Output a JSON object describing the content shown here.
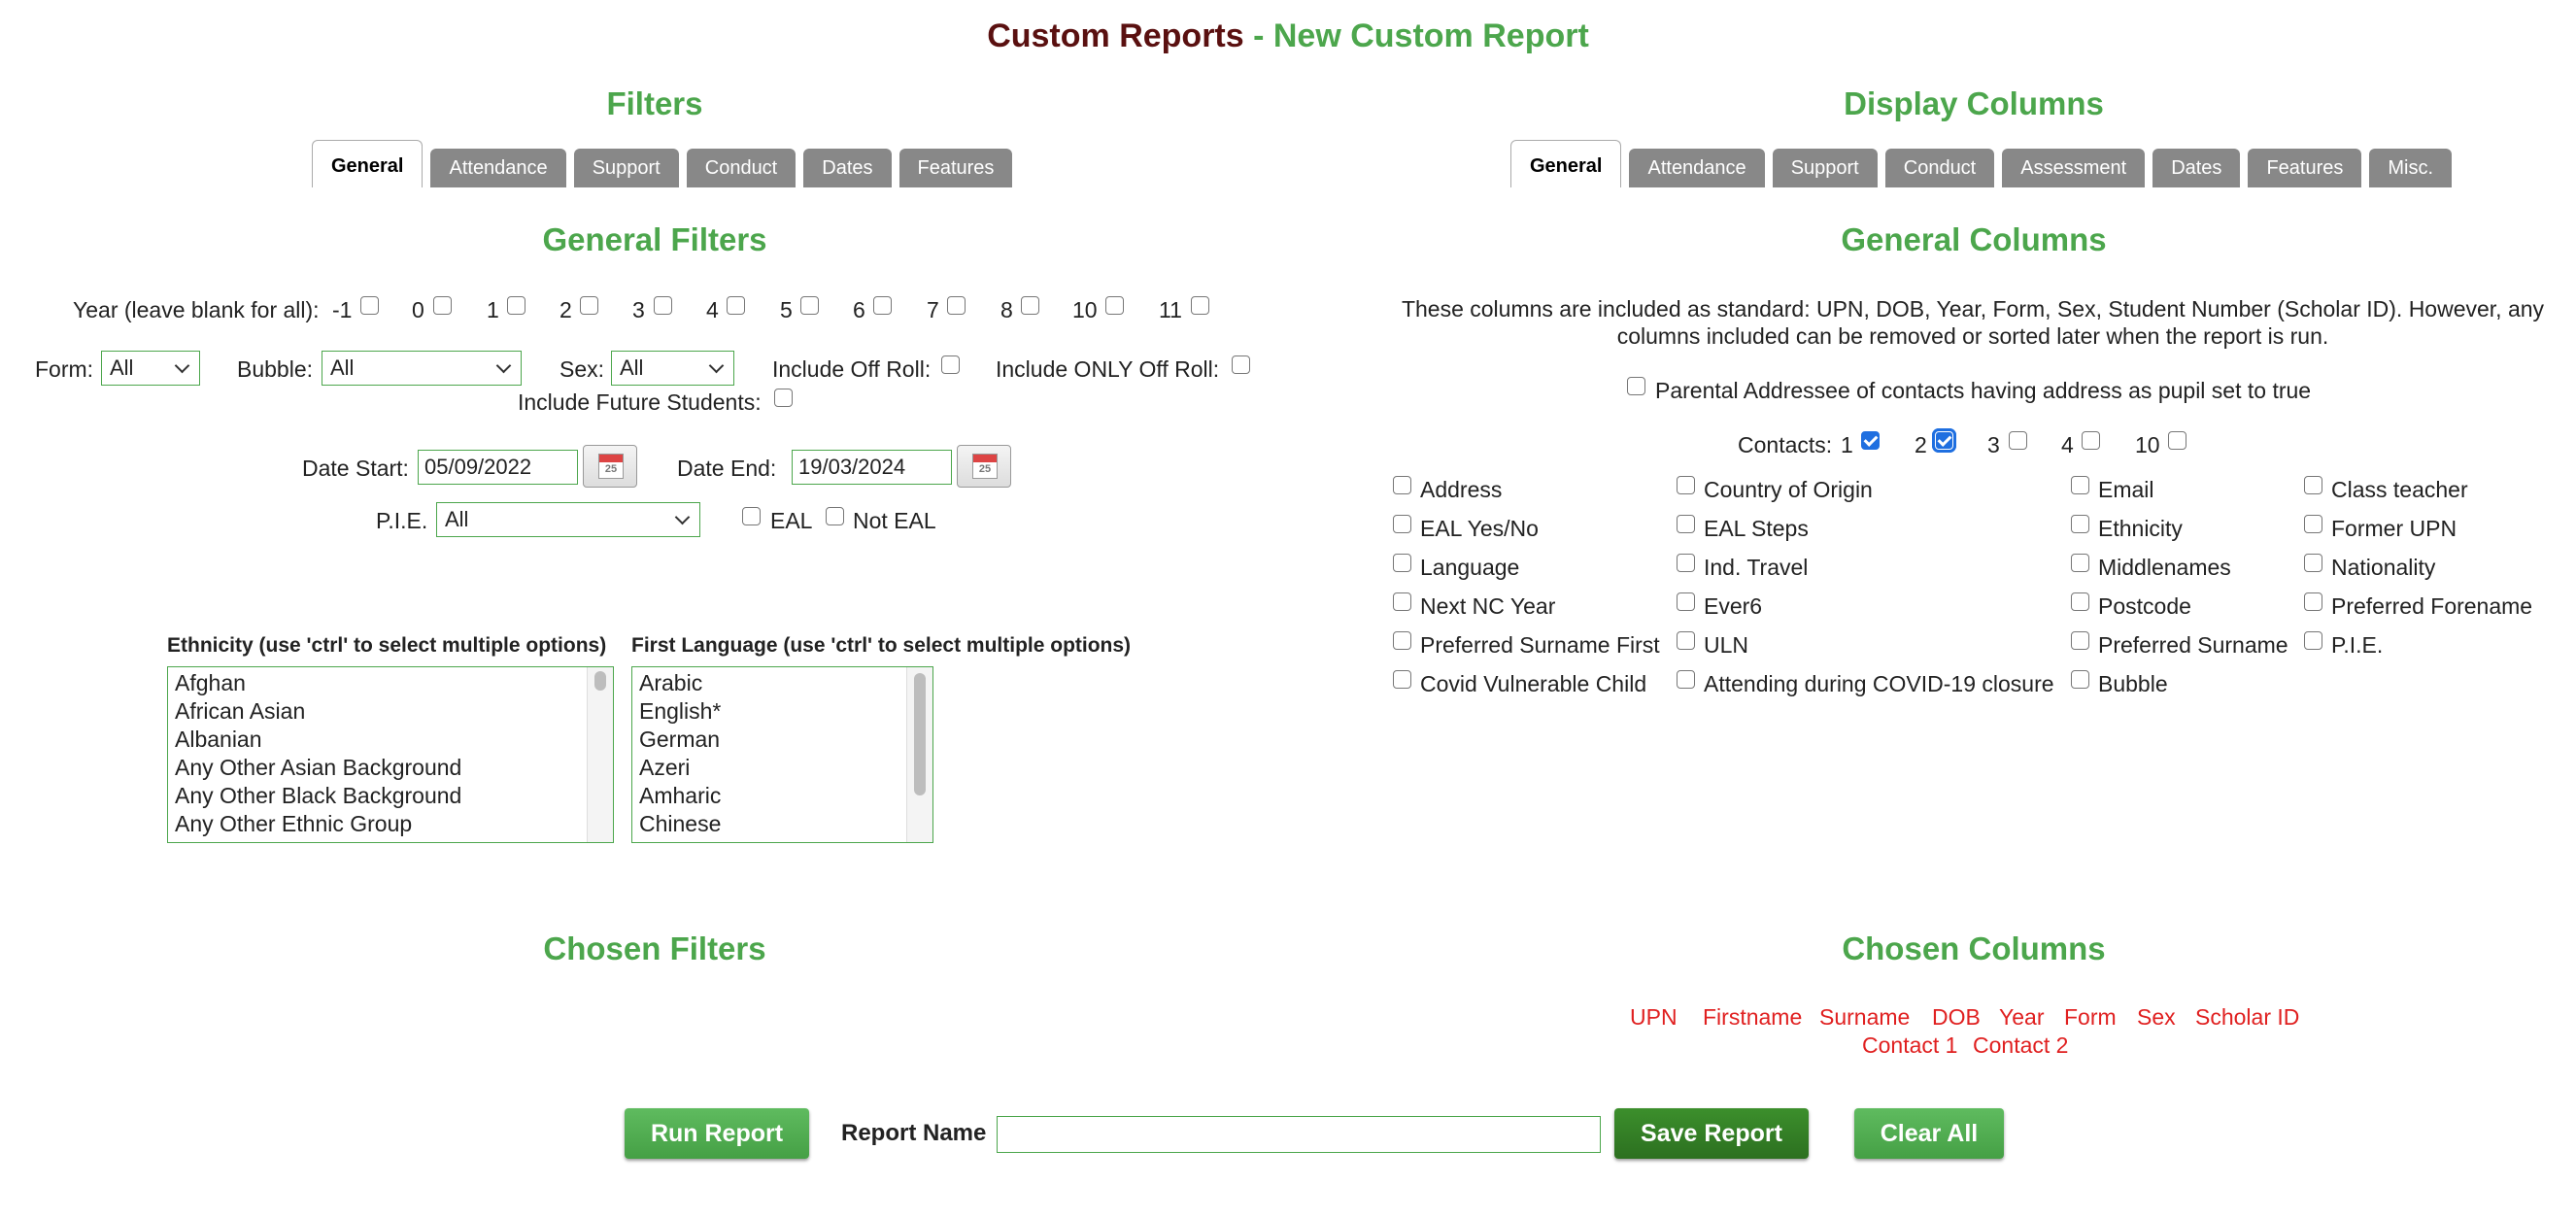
{
  "title": {
    "main": "Custom Reports",
    "sep": " - ",
    "sub": "New Custom Report"
  },
  "filters": {
    "heading": "Filters",
    "tabs": [
      "General",
      "Attendance",
      "Support",
      "Conduct",
      "Dates",
      "Features"
    ],
    "section_heading": "General Filters",
    "year_label": "Year (leave blank for all): ",
    "years": [
      "-1",
      "0",
      "1",
      "2",
      "3",
      "4",
      "5",
      "6",
      "7",
      "8",
      "10",
      "11"
    ],
    "form_label": "Form:",
    "form_value": "All",
    "bubble_label": "Bubble:",
    "bubble_value": "All",
    "sex_label": "Sex:",
    "sex_value": "All",
    "off_roll_label": "Include Off Roll:",
    "only_off_roll_label": "Include ONLY Off Roll:",
    "future_label": "Include Future Students:",
    "date_start_label": "Date Start:",
    "date_start": "05/09/2022",
    "date_end_label": "Date End:",
    "date_end": "19/03/2024",
    "pie_label": "P.I.E.",
    "pie_value": "All",
    "eal_label": "EAL",
    "not_eal_label": "Not EAL",
    "ethnicity_label": "Ethnicity (use 'ctrl' to select multiple options)",
    "ethnicity_options": [
      "Afghan",
      "African Asian",
      "Albanian",
      "Any Other Asian Background",
      "Any Other Black Background",
      "Any Other Ethnic Group"
    ],
    "language_label": "First Language (use 'ctrl' to select multiple options)",
    "language_options": [
      "Arabic",
      "English*",
      "German",
      "Azeri",
      "Amharic",
      "Chinese"
    ],
    "chosen_heading": "Chosen Filters"
  },
  "columns": {
    "heading": "Display Columns",
    "tabs": [
      "General",
      "Attendance",
      "Support",
      "Conduct",
      "Assessment",
      "Dates",
      "Features",
      "Misc."
    ],
    "section_heading": "General Columns",
    "note_line1": "These columns are included as standard: UPN, DOB, Year, Form, Sex, Student Number (Scholar ID). However, any",
    "note_line2": "columns included can be removed or sorted later when the report is run.",
    "parental_label": "Parental Addressee of contacts having address as pupil set to true",
    "contacts_label": "Contacts: ",
    "contacts": [
      "1",
      "2",
      "3",
      "4",
      "10"
    ],
    "items": [
      [
        "Address",
        "Country of Origin",
        "Email",
        "Class teacher"
      ],
      [
        "EAL Yes/No",
        "EAL Steps",
        "Ethnicity",
        "Former UPN"
      ],
      [
        "Language",
        "Ind. Travel",
        "Middlenames",
        "Nationality"
      ],
      [
        "Next NC Year",
        "Ever6",
        "Postcode",
        "Preferred Forename"
      ],
      [
        "Preferred Surname First",
        "ULN",
        "Preferred Surname",
        "P.I.E."
      ],
      [
        "Covid Vulnerable Child",
        "Attending during COVID-19 closure",
        "Bubble",
        ""
      ]
    ],
    "chosen_heading": "Chosen Columns",
    "chosen_row1": [
      "UPN",
      "Firstname",
      "Surname",
      "DOB",
      "Year",
      "Form",
      "Sex",
      "Scholar ID"
    ],
    "chosen_row2": [
      "Contact 1",
      "Contact 2"
    ]
  },
  "footer": {
    "run_label": "Run Report",
    "report_name_label": "Report Name",
    "report_name_value": "",
    "save_label": "Save Report",
    "clear_label": "Clear All"
  }
}
